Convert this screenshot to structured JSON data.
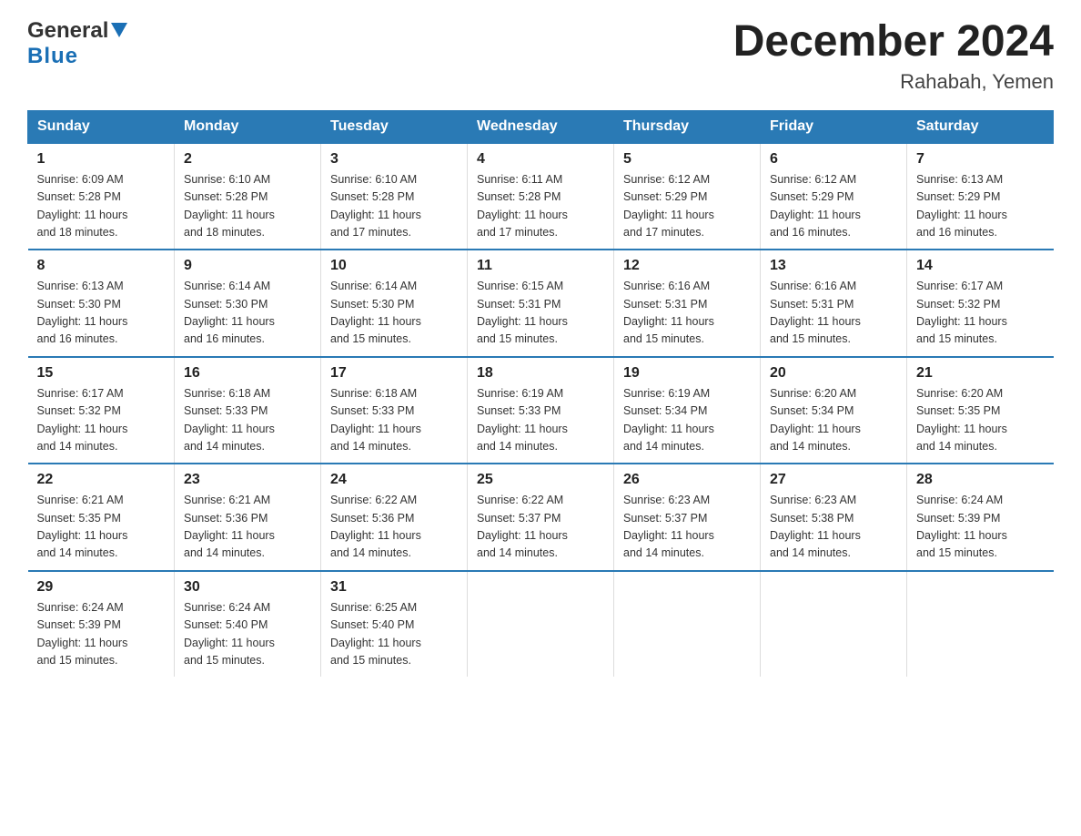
{
  "logo": {
    "general": "General",
    "blue": "Blue"
  },
  "title": "December 2024",
  "subtitle": "Rahabah, Yemen",
  "weekdays": [
    "Sunday",
    "Monday",
    "Tuesday",
    "Wednesday",
    "Thursday",
    "Friday",
    "Saturday"
  ],
  "weeks": [
    [
      {
        "day": "1",
        "sunrise": "6:09 AM",
        "sunset": "5:28 PM",
        "daylight": "11 hours and 18 minutes."
      },
      {
        "day": "2",
        "sunrise": "6:10 AM",
        "sunset": "5:28 PM",
        "daylight": "11 hours and 18 minutes."
      },
      {
        "day": "3",
        "sunrise": "6:10 AM",
        "sunset": "5:28 PM",
        "daylight": "11 hours and 17 minutes."
      },
      {
        "day": "4",
        "sunrise": "6:11 AM",
        "sunset": "5:28 PM",
        "daylight": "11 hours and 17 minutes."
      },
      {
        "day": "5",
        "sunrise": "6:12 AM",
        "sunset": "5:29 PM",
        "daylight": "11 hours and 17 minutes."
      },
      {
        "day": "6",
        "sunrise": "6:12 AM",
        "sunset": "5:29 PM",
        "daylight": "11 hours and 16 minutes."
      },
      {
        "day": "7",
        "sunrise": "6:13 AM",
        "sunset": "5:29 PM",
        "daylight": "11 hours and 16 minutes."
      }
    ],
    [
      {
        "day": "8",
        "sunrise": "6:13 AM",
        "sunset": "5:30 PM",
        "daylight": "11 hours and 16 minutes."
      },
      {
        "day": "9",
        "sunrise": "6:14 AM",
        "sunset": "5:30 PM",
        "daylight": "11 hours and 16 minutes."
      },
      {
        "day": "10",
        "sunrise": "6:14 AM",
        "sunset": "5:30 PM",
        "daylight": "11 hours and 15 minutes."
      },
      {
        "day": "11",
        "sunrise": "6:15 AM",
        "sunset": "5:31 PM",
        "daylight": "11 hours and 15 minutes."
      },
      {
        "day": "12",
        "sunrise": "6:16 AM",
        "sunset": "5:31 PM",
        "daylight": "11 hours and 15 minutes."
      },
      {
        "day": "13",
        "sunrise": "6:16 AM",
        "sunset": "5:31 PM",
        "daylight": "11 hours and 15 minutes."
      },
      {
        "day": "14",
        "sunrise": "6:17 AM",
        "sunset": "5:32 PM",
        "daylight": "11 hours and 15 minutes."
      }
    ],
    [
      {
        "day": "15",
        "sunrise": "6:17 AM",
        "sunset": "5:32 PM",
        "daylight": "11 hours and 14 minutes."
      },
      {
        "day": "16",
        "sunrise": "6:18 AM",
        "sunset": "5:33 PM",
        "daylight": "11 hours and 14 minutes."
      },
      {
        "day": "17",
        "sunrise": "6:18 AM",
        "sunset": "5:33 PM",
        "daylight": "11 hours and 14 minutes."
      },
      {
        "day": "18",
        "sunrise": "6:19 AM",
        "sunset": "5:33 PM",
        "daylight": "11 hours and 14 minutes."
      },
      {
        "day": "19",
        "sunrise": "6:19 AM",
        "sunset": "5:34 PM",
        "daylight": "11 hours and 14 minutes."
      },
      {
        "day": "20",
        "sunrise": "6:20 AM",
        "sunset": "5:34 PM",
        "daylight": "11 hours and 14 minutes."
      },
      {
        "day": "21",
        "sunrise": "6:20 AM",
        "sunset": "5:35 PM",
        "daylight": "11 hours and 14 minutes."
      }
    ],
    [
      {
        "day": "22",
        "sunrise": "6:21 AM",
        "sunset": "5:35 PM",
        "daylight": "11 hours and 14 minutes."
      },
      {
        "day": "23",
        "sunrise": "6:21 AM",
        "sunset": "5:36 PM",
        "daylight": "11 hours and 14 minutes."
      },
      {
        "day": "24",
        "sunrise": "6:22 AM",
        "sunset": "5:36 PM",
        "daylight": "11 hours and 14 minutes."
      },
      {
        "day": "25",
        "sunrise": "6:22 AM",
        "sunset": "5:37 PM",
        "daylight": "11 hours and 14 minutes."
      },
      {
        "day": "26",
        "sunrise": "6:23 AM",
        "sunset": "5:37 PM",
        "daylight": "11 hours and 14 minutes."
      },
      {
        "day": "27",
        "sunrise": "6:23 AM",
        "sunset": "5:38 PM",
        "daylight": "11 hours and 14 minutes."
      },
      {
        "day": "28",
        "sunrise": "6:24 AM",
        "sunset": "5:39 PM",
        "daylight": "11 hours and 15 minutes."
      }
    ],
    [
      {
        "day": "29",
        "sunrise": "6:24 AM",
        "sunset": "5:39 PM",
        "daylight": "11 hours and 15 minutes."
      },
      {
        "day": "30",
        "sunrise": "6:24 AM",
        "sunset": "5:40 PM",
        "daylight": "11 hours and 15 minutes."
      },
      {
        "day": "31",
        "sunrise": "6:25 AM",
        "sunset": "5:40 PM",
        "daylight": "11 hours and 15 minutes."
      },
      null,
      null,
      null,
      null
    ]
  ],
  "labels": {
    "sunrise": "Sunrise:",
    "sunset": "Sunset:",
    "daylight": "Daylight:"
  }
}
